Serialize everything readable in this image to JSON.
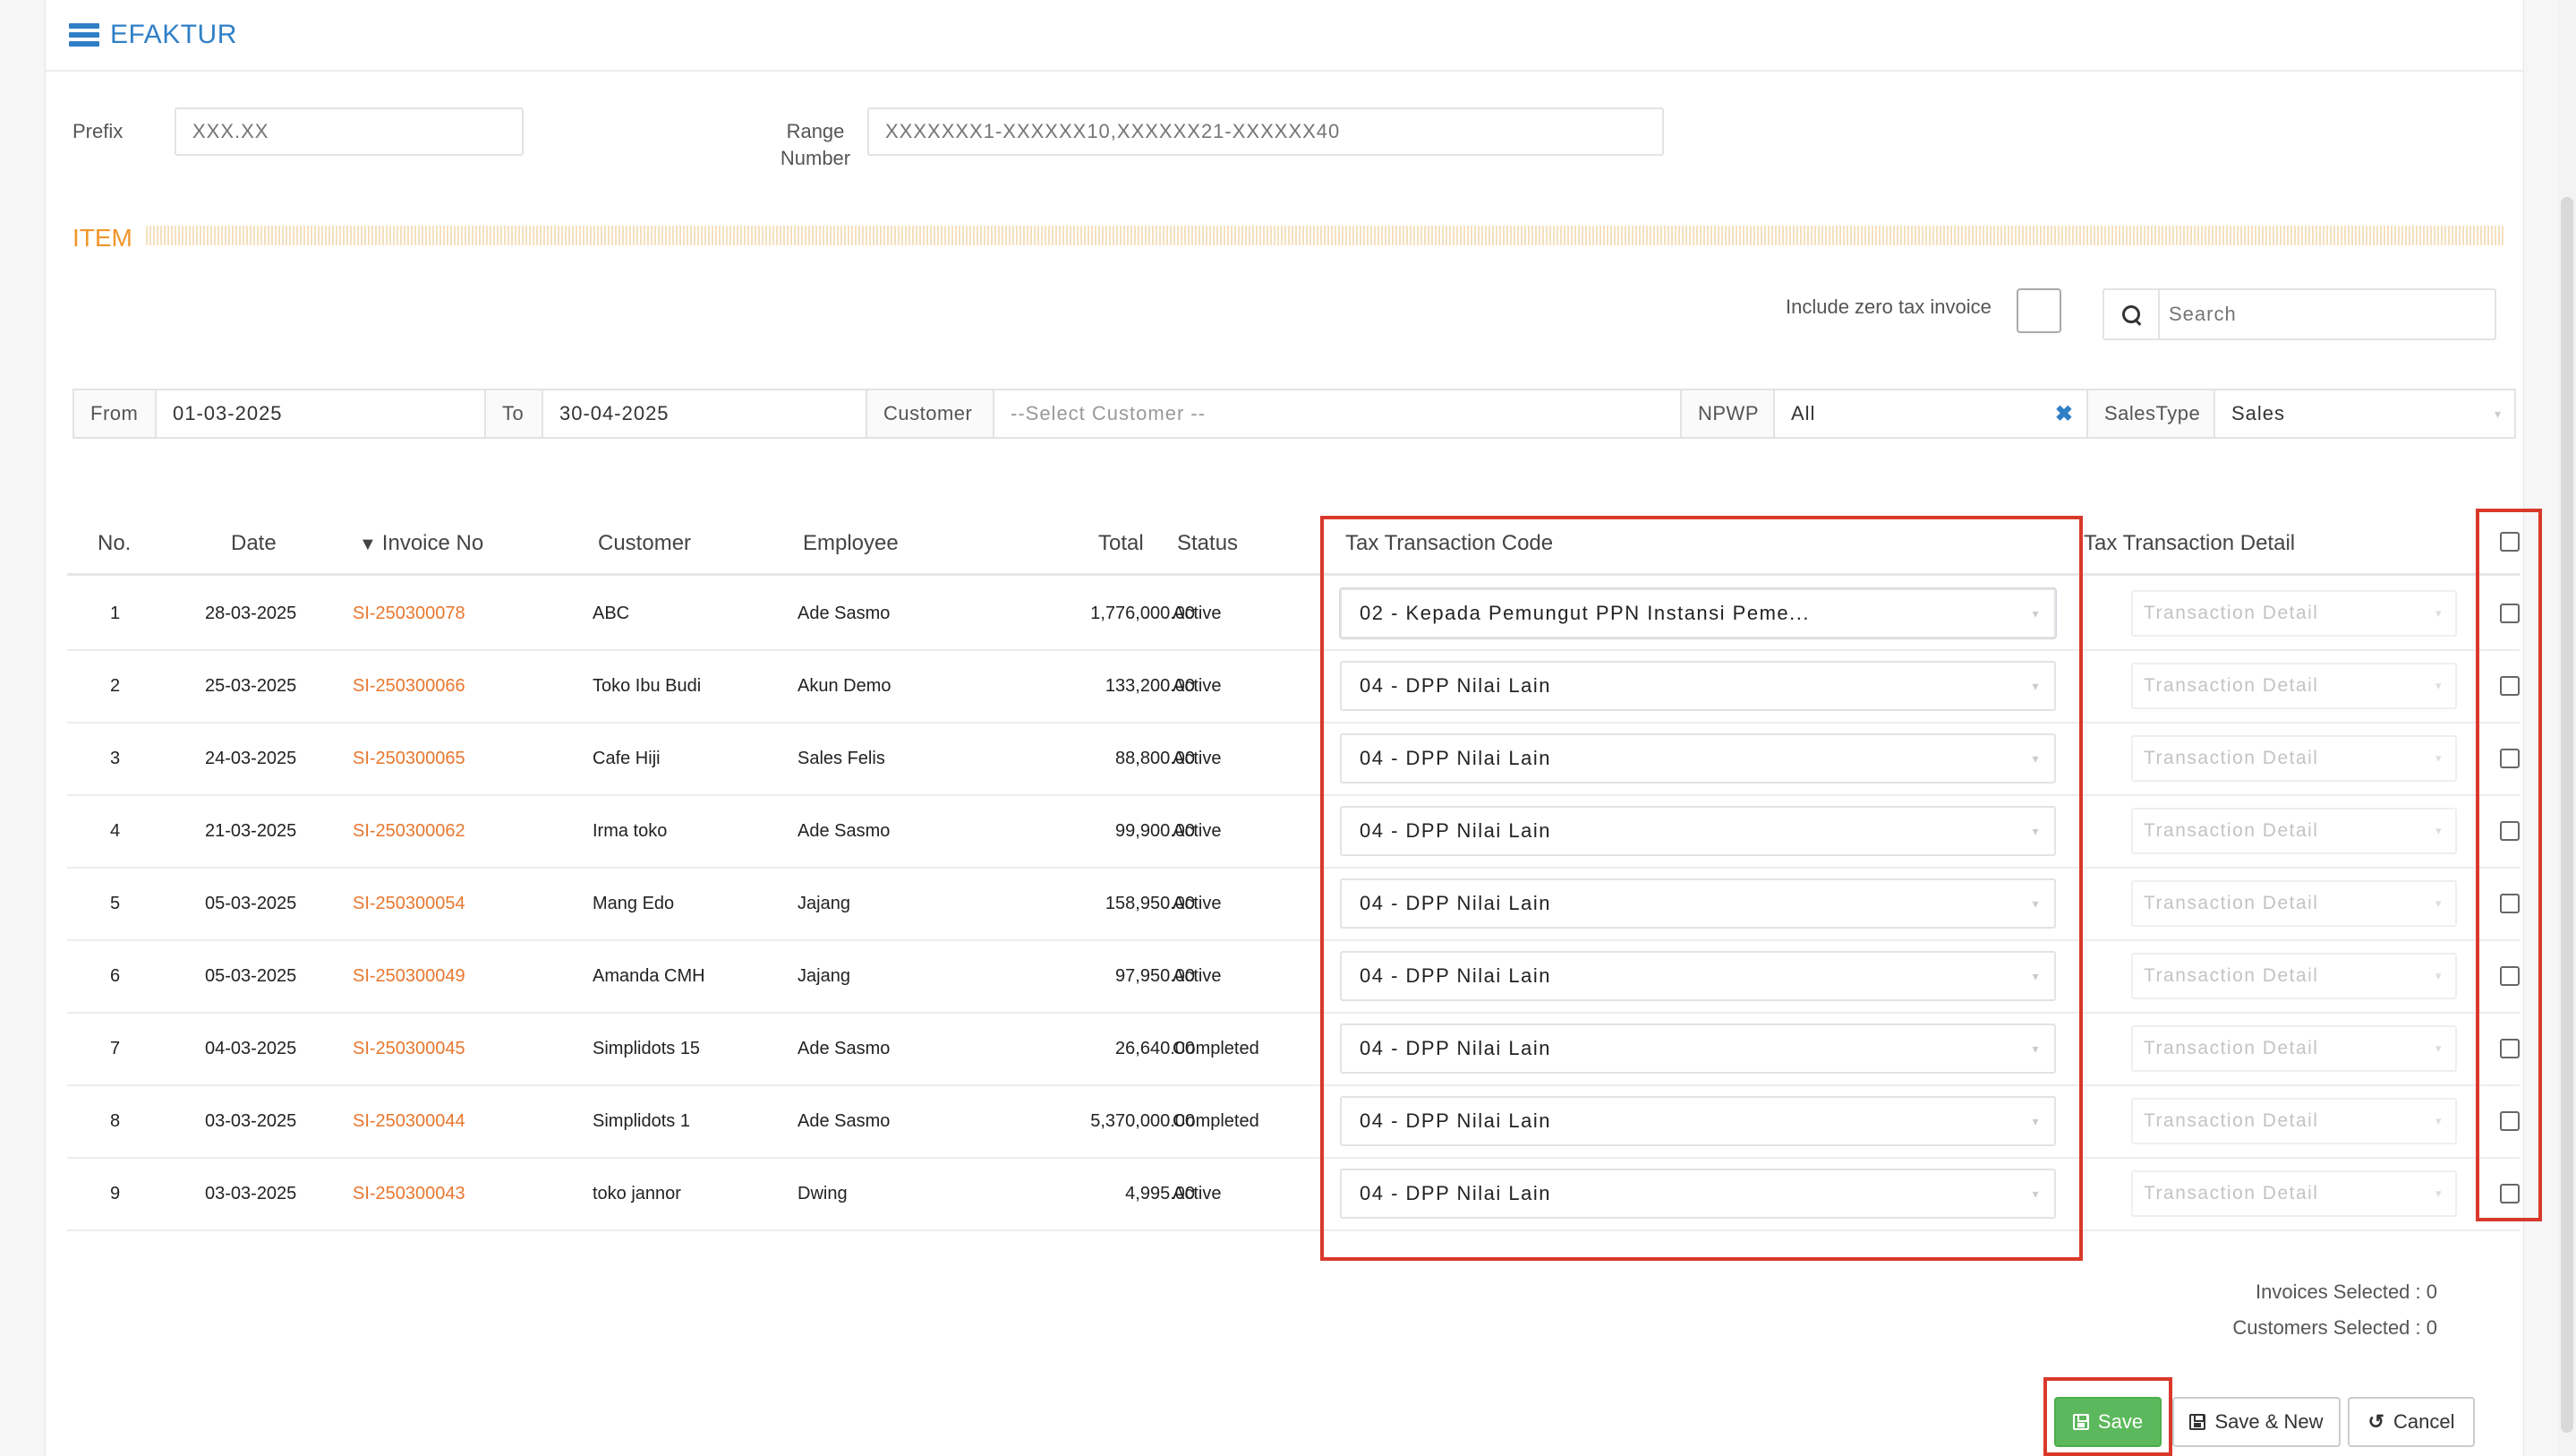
{
  "header": {
    "title": "EFAKTUR"
  },
  "prefix": {
    "label": "Prefix",
    "placeholder": "XXX.XX"
  },
  "range": {
    "label_line1": "Range",
    "label_line2": "Number",
    "placeholder": "XXXXXXX1-XXXXXX10,XXXXXX21-XXXXXX40"
  },
  "section": {
    "title": "ITEM"
  },
  "zero_tax": {
    "label": "Include zero tax invoice",
    "checked": false
  },
  "search": {
    "placeholder": "Search"
  },
  "filters": {
    "from_label": "From",
    "from_value": "01-03-2025",
    "to_label": "To",
    "to_value": "30-04-2025",
    "customer_label": "Customer",
    "customer_placeholder": "--Select Customer --",
    "npwp_label": "NPWP",
    "npwp_value": "All",
    "salestype_label": "SalesType",
    "salestype_value": "Sales"
  },
  "table": {
    "headers": {
      "no": "No.",
      "date": "Date",
      "invoice": "Invoice No",
      "customer": "Customer",
      "employee": "Employee",
      "total": "Total",
      "status": "Status",
      "tax_code": "Tax Transaction Code",
      "tax_detail": "Tax Transaction Detail"
    },
    "detail_placeholder": "Transaction Detail",
    "rows": [
      {
        "no": "1",
        "date": "28-03-2025",
        "invoice": "SI-250300078",
        "customer": "ABC",
        "employee": "Ade Sasmo",
        "total": "1,776,000.00",
        "status": "Active",
        "tax_code": "02 - Kepada Pemungut PPN Instansi Peme..."
      },
      {
        "no": "2",
        "date": "25-03-2025",
        "invoice": "SI-250300066",
        "customer": "Toko Ibu Budi",
        "employee": "Akun Demo",
        "total": "133,200.00",
        "status": "Active",
        "tax_code": "04 - DPP Nilai Lain"
      },
      {
        "no": "3",
        "date": "24-03-2025",
        "invoice": "SI-250300065",
        "customer": "Cafe Hiji",
        "employee": "Sales Felis",
        "total": "88,800.00",
        "status": "Active",
        "tax_code": "04 - DPP Nilai Lain"
      },
      {
        "no": "4",
        "date": "21-03-2025",
        "invoice": "SI-250300062",
        "customer": "Irma toko",
        "employee": "Ade Sasmo",
        "total": "99,900.00",
        "status": "Active",
        "tax_code": "04 - DPP Nilai Lain"
      },
      {
        "no": "5",
        "date": "05-03-2025",
        "invoice": "SI-250300054",
        "customer": "Mang Edo",
        "employee": "Jajang",
        "total": "158,950.00",
        "status": "Active",
        "tax_code": "04 - DPP Nilai Lain"
      },
      {
        "no": "6",
        "date": "05-03-2025",
        "invoice": "SI-250300049",
        "customer": "Amanda CMH",
        "employee": "Jajang",
        "total": "97,950.00",
        "status": "Active",
        "tax_code": "04 - DPP Nilai Lain"
      },
      {
        "no": "7",
        "date": "04-03-2025",
        "invoice": "SI-250300045",
        "customer": "Simplidots 15",
        "employee": "Ade Sasmo",
        "total": "26,640.00",
        "status": "Completed",
        "tax_code": "04 - DPP Nilai Lain"
      },
      {
        "no": "8",
        "date": "03-03-2025",
        "invoice": "SI-250300044",
        "customer": "Simplidots 1",
        "employee": "Ade Sasmo",
        "total": "5,370,000.00",
        "status": "Completed",
        "tax_code": "04 - DPP Nilai Lain"
      },
      {
        "no": "9",
        "date": "03-03-2025",
        "invoice": "SI-250300043",
        "customer": "toko jannor",
        "employee": "Dwing",
        "total": "4,995.00",
        "status": "Active",
        "tax_code": "04 - DPP Nilai Lain"
      }
    ]
  },
  "summary": {
    "invoices_selected": "Invoices Selected : 0",
    "customers_selected": "Customers Selected : 0"
  },
  "buttons": {
    "save": "Save",
    "save_new": "Save & New",
    "cancel": "Cancel"
  },
  "colors": {
    "accent": "#2f7fc6",
    "section": "#f0962b",
    "link": "#e8772e",
    "highlight": "#d9392b",
    "save": "#5cb85c"
  }
}
